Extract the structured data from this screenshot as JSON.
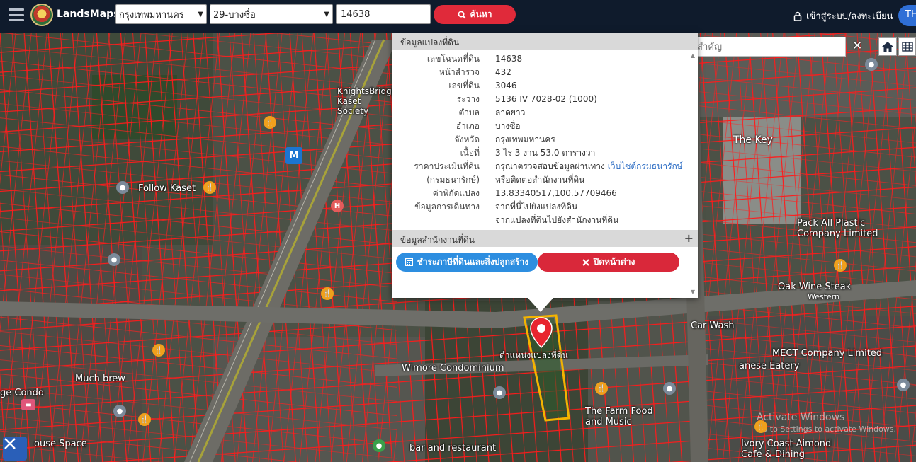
{
  "header": {
    "brand": "LandsMaps",
    "province": "กรุงเทพมหานคร",
    "district": "29-บางซื่อ",
    "deed_number": "14638",
    "search_label": "ค้นหา",
    "login_label": "เข้าสู่ระบบ/ลงทะเบียน",
    "lang_label": "TH"
  },
  "place_search": {
    "placeholder": "ค้นหาสถานที่สำคัญ",
    "close_label": "✕"
  },
  "popup": {
    "section_land_title": "ข้อมูลแปลงที่ดิน",
    "section_office_title": "ข้อมูลสำนักงานที่ดิน",
    "expand_label": "+",
    "rows": {
      "deed_no": {
        "label": "เลขโฉนดที่ดิน",
        "value": "14638"
      },
      "survey_page": {
        "label": "หน้าสำรวจ",
        "value": "432"
      },
      "land_no": {
        "label": "เลขที่ดิน",
        "value": "3046"
      },
      "sheet": {
        "label": "ระวาง",
        "value": "5136 IV 7028-02 (1000)"
      },
      "subdistrict": {
        "label": "ตำบล",
        "value": "ลาดยาว"
      },
      "district": {
        "label": "อำเภอ",
        "value": "บางซื่อ"
      },
      "province": {
        "label": "จังหวัด",
        "value": "กรุงเทพมหานคร"
      },
      "area": {
        "label": "เนื้อที่",
        "value": "3 ไร่ 3 งาน 53.0 ตารางวา"
      },
      "appraisal": {
        "label": "ราคาประเมินที่ดิน",
        "value": "กรุณาตรวจสอบข้อมูลผ่านทาง",
        "link": "เว็บไซต์กรมธนารักษ์"
      },
      "appraisal2": {
        "label": "(กรมธนารักษ์)",
        "value": "หรือติดต่อสำนักงานที่ดิน"
      },
      "coords": {
        "label": "ค่าพิกัดแปลง",
        "value": "13.83340517,100.57709466"
      },
      "travel": {
        "label": "ข้อมูลการเดินทาง",
        "link1": "จากที่นี่ไปยังแปลงที่ดิน",
        "link2": "จากแปลงที่ดินไปยังสำนักงานที่ดิน"
      }
    },
    "btn_tax": "ชำระภาษีที่ดินและสิ่งปลูกสร้าง",
    "btn_close": "ปิดหน้าต่าง"
  },
  "map_labels": {
    "parcel_position": "ตำแหน่งแปลงที่ดิน",
    "wimore": "Wimore Condominium",
    "the_key": "The Key",
    "pack_all": "Pack All Plastic Company Limited",
    "oak_wine": "Oak Wine Steak",
    "western": "Western",
    "carwash": "Car Wash",
    "mect": "MECT Company Limited",
    "eatery": "anese Eatery",
    "farm_food": "The Farm Food and Music",
    "much_brew": "Much brew",
    "condo": "ge Condo",
    "follow_kaset": "Follow Kaset",
    "knights": "KnightsBridge Kaset Society",
    "ivory": "Ivory Coast Aimond Cafe & Dining",
    "bar_restaurant": "bar and restaurant",
    "activate": "Go to Settings to activate Windows.",
    "activate_title": "Activate Windows",
    "house_space": "ouse Space",
    "mrt": "M"
  }
}
